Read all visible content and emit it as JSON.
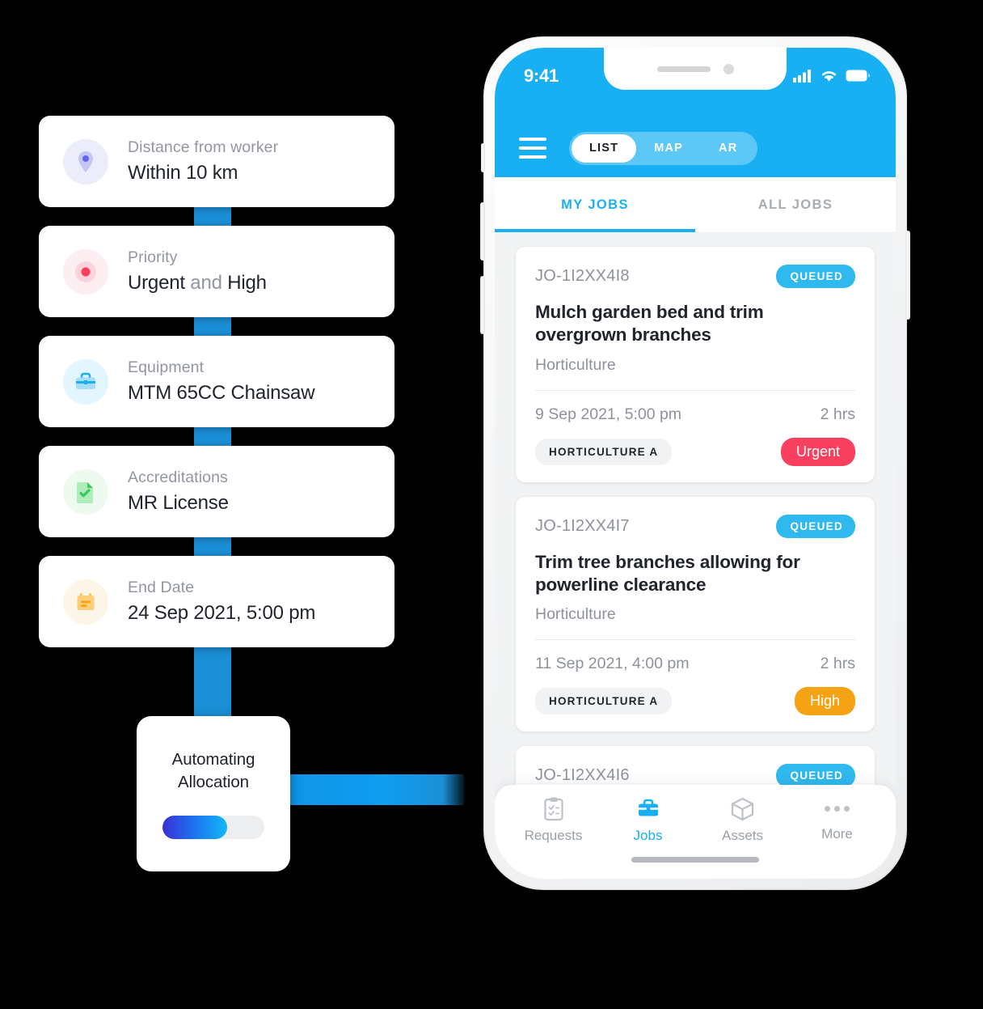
{
  "criteria": {
    "cards": [
      {
        "label": "Distance from worker",
        "value": "Within 10 km",
        "icon": "location-pin-icon",
        "icon_bg": "#ecedfb",
        "icon_color": "#6366f1"
      },
      {
        "label": "Priority",
        "value_parts": [
          "Urgent",
          " and ",
          "High"
        ],
        "value": "Urgent and High",
        "icon": "priority-target-icon",
        "icon_bg": "#fdeef1",
        "icon_color": "#f9405e"
      },
      {
        "label": "Equipment",
        "value": "MTM 65CC Chainsaw",
        "icon": "toolbox-icon",
        "icon_bg": "#e3f5fe",
        "icon_color": "#18b0f3"
      },
      {
        "label": "Accreditations",
        "value": "MR License",
        "icon": "document-check-icon",
        "icon_bg": "#edfaef",
        "icon_color": "#4ccf6a"
      },
      {
        "label": "End Date",
        "value": "24 Sep 2021, 5:00 pm",
        "icon": "calendar-icon",
        "icon_bg": "#fdf6e8",
        "icon_color": "#fbbf4c"
      }
    ]
  },
  "automation": {
    "title_line1": "Automating",
    "title_line2": "Allocation",
    "toggle_state": "on"
  },
  "phone": {
    "status_bar": {
      "time": "9:41"
    },
    "app_bar": {
      "menu_icon": "hamburger-menu-icon",
      "segments": [
        {
          "label": "LIST",
          "active": true
        },
        {
          "label": "MAP",
          "active": false
        },
        {
          "label": "AR",
          "active": false
        }
      ]
    },
    "tabs": [
      {
        "label": "MY JOBS",
        "active": true
      },
      {
        "label": "ALL JOBS",
        "active": false
      }
    ],
    "jobs": [
      {
        "id": "JO-1I2XX4I8",
        "status": "QUEUED",
        "title": "Mulch garden bed and trim overgrown branches",
        "category": "Horticulture",
        "date": "9 Sep 2021, 5:00 pm",
        "duration": "2 hrs",
        "team": "HORTICULTURE A",
        "priority": "Urgent",
        "priority_class": "urgent"
      },
      {
        "id": "JO-1I2XX4I7",
        "status": "QUEUED",
        "title": "Trim tree branches allowing for powerline clearance",
        "category": "Horticulture",
        "date": "11 Sep 2021, 4:00 pm",
        "duration": "2 hrs",
        "team": "HORTICULTURE A",
        "priority": "High",
        "priority_class": "high"
      },
      {
        "id": "JO-1I2XX4I6",
        "status": "QUEUED",
        "title": "",
        "category": "",
        "date": "",
        "duration": "",
        "team": "",
        "priority": "",
        "priority_class": ""
      }
    ],
    "fab": {
      "icon": "plus-icon"
    },
    "tabbar": [
      {
        "label": "Requests",
        "icon": "clipboard-icon",
        "active": false
      },
      {
        "label": "Jobs",
        "icon": "briefcase-icon",
        "active": true
      },
      {
        "label": "Assets",
        "icon": "cube-icon",
        "active": false
      },
      {
        "label": "More",
        "icon": "ellipsis-icon",
        "active": false
      }
    ]
  },
  "colors": {
    "brand_blue": "#18b0f3",
    "connector_blue": "#1b8fd6",
    "urgent_red": "#f9405e",
    "high_orange": "#f5a214",
    "queued_blue": "#30b9ef"
  }
}
